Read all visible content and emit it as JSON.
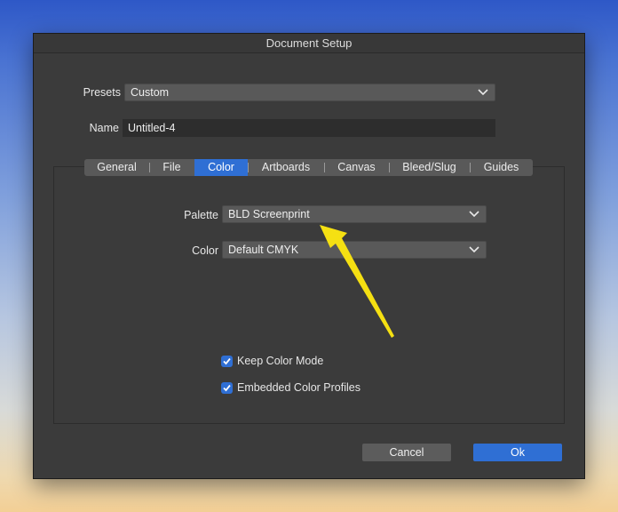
{
  "dialog": {
    "title": "Document Setup"
  },
  "presets": {
    "label": "Presets",
    "value": "Custom"
  },
  "name": {
    "label": "Name",
    "value": "Untitled-4"
  },
  "tabs": [
    {
      "label": "General"
    },
    {
      "label": "File"
    },
    {
      "label": "Color",
      "active": true
    },
    {
      "label": "Artboards"
    },
    {
      "label": "Canvas"
    },
    {
      "label": "Bleed/Slug"
    },
    {
      "label": "Guides"
    }
  ],
  "color_tab": {
    "palette": {
      "label": "Palette",
      "value": "BLD Screenprint"
    },
    "color": {
      "label": "Color",
      "value": "Default CMYK"
    },
    "keep_color_mode": {
      "label": "Keep Color Mode",
      "checked": true
    },
    "embedded_profiles": {
      "label": "Embedded Color Profiles",
      "checked": true
    }
  },
  "buttons": {
    "cancel": "Cancel",
    "ok": "Ok"
  },
  "colors": {
    "accent": "#2f6fd4",
    "annotation_arrow": "#f5e012"
  },
  "icons": {
    "dropdown": "chevron-down-icon",
    "checkbox": "checkmark-icon",
    "annotation": "arrow-annotation"
  }
}
